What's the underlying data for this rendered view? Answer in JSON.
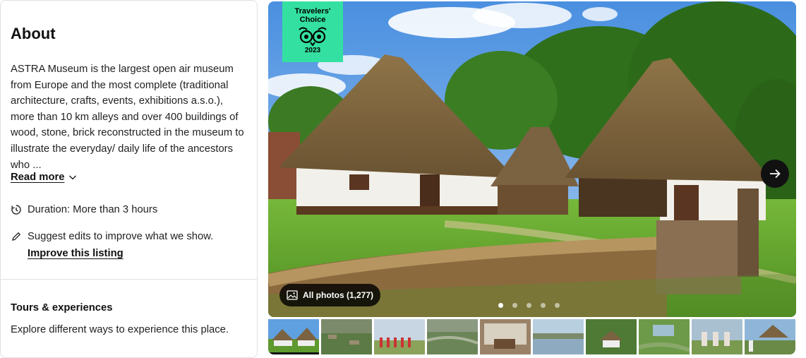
{
  "about": {
    "title": "About",
    "description": "ASTRA Museum is the largest open air museum from Europe and the most complete (traditional architecture, crafts, events, exhibitions a.s.o.), more than 10 km alleys and over 400 buildings of wood, stone, brick reconstructed in the museum to illustrate the everyday/ daily life of the ancestors who ...",
    "read_more": "Read more",
    "duration": "Duration: More than 3 hours",
    "suggest": "Suggest edits to improve what we show.",
    "improve": "Improve this listing"
  },
  "tours": {
    "title": "Tours & experiences",
    "description": "Explore different ways to experience this place."
  },
  "gallery": {
    "badge": {
      "line1": "Travelers'",
      "line2": "Choice",
      "year": "2023",
      "color": "#34e0a1"
    },
    "all_photos": "All photos (1,277)",
    "dots_count": 5,
    "active_dot": 0,
    "thumbnail_count": 10
  },
  "icons": {
    "duration": "clock-icon",
    "suggest": "pencil-icon",
    "read_more": "chevron-down-icon",
    "all_photos": "image-icon",
    "next": "arrow-right-icon"
  }
}
